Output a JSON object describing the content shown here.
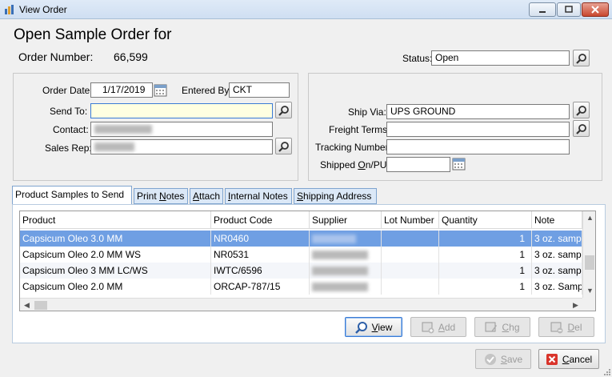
{
  "window": {
    "title": "View Order"
  },
  "header": {
    "heading": "Open Sample Order for",
    "order_number_label": "Order Number:",
    "order_number_value": "66,599",
    "status_label": "Status:",
    "status_value": "Open"
  },
  "left_group": {
    "order_date_label": "Order Date:",
    "order_date_value": "1/17/2019",
    "entered_by_label": "Entered By:",
    "entered_by_value": "CKT",
    "send_to_label": "Send To:",
    "send_to_value": "",
    "contact_label": "Contact:",
    "sales_rep_label": "Sales Rep:"
  },
  "right_group": {
    "ship_via_label": "Ship Via:",
    "ship_via_value": "UPS GROUND",
    "freight_terms_label": "Freight Terms:",
    "freight_terms_value": "",
    "tracking_label": "Tracking Number:",
    "tracking_value": "",
    "shipped_label_pre": "Shipped ",
    "shipped_label_key": "O",
    "shipped_label_post": "n/PU:",
    "shipped_value": ""
  },
  "tabs": [
    {
      "label": "Product Samples to Send",
      "active": true
    },
    {
      "label": "Print Notes",
      "key": "N"
    },
    {
      "label": "Attach",
      "key": "A"
    },
    {
      "label": "Internal Notes",
      "key": "I"
    },
    {
      "label": "Shipping Address",
      "key": "S"
    }
  ],
  "grid": {
    "columns": [
      "Product",
      "Product Code",
      "Supplier",
      "Lot Number",
      "Quantity",
      "Note"
    ],
    "rows": [
      {
        "product": "Capsicum Oleo 3.0 MM",
        "code": "NR0460",
        "lot": "",
        "qty": "1",
        "note": "3 oz. samp",
        "selected": true
      },
      {
        "product": "Capsicum Oleo 2.0 MM WS",
        "code": "NR0531",
        "lot": "",
        "qty": "1",
        "note": "3 oz. samp"
      },
      {
        "product": "Capsicum Oleo 3 MM  LC/WS",
        "code": "IWTC/6596",
        "lot": "",
        "qty": "1",
        "note": "3 oz. samp"
      },
      {
        "product": "Capsicum Oleo 2.0 MM",
        "code": "ORCAP-787/15",
        "lot": "",
        "qty": "1",
        "note": "3 oz. Samp"
      }
    ]
  },
  "grid_buttons": {
    "view": {
      "key": "V",
      "rest": "iew"
    },
    "add": {
      "key": "A",
      "rest": "dd"
    },
    "chg": {
      "key": "C",
      "rest": "hg"
    },
    "del": {
      "key": "D",
      "rest": "el"
    }
  },
  "footer_buttons": {
    "save": {
      "key": "S",
      "rest": "ave"
    },
    "cancel": {
      "key": "C",
      "rest": "ancel"
    }
  },
  "colors": {
    "selection": "#6f9fe3",
    "accent": "#3a7bd5"
  }
}
